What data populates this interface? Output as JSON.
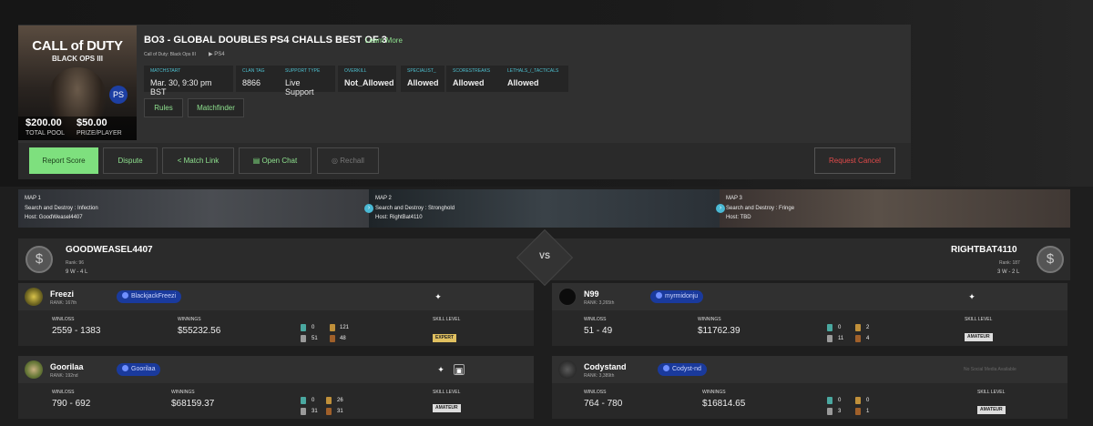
{
  "game": {
    "cover_title": "CALL of DUTY",
    "cover_subtitle": "BLACK OPS III",
    "platform_badge": "PS"
  },
  "pool": {
    "total": "$200.00",
    "total_label": "TOTAL POOL",
    "prize": "$50.00",
    "prize_label": "PRIZE/PLAYER"
  },
  "match": {
    "title": "BO3 - GLOBAL DOUBLES PS4 CHALLS BEST OF 3",
    "learn_more": "Learn More",
    "game_name": "Call of Duty: Black Ops III",
    "platform": "PS4"
  },
  "stats": [
    {
      "key": "MATCHSTART",
      "value": "Mar. 30, 9:30 pm BST"
    },
    {
      "key": "CLAN TAG",
      "value": "8866"
    },
    {
      "key": "SUPPORT TYPE",
      "value": "Live Support"
    },
    {
      "key": "OVERKILL",
      "value": "Not_Allowed"
    },
    {
      "key": "SPECIALIST_",
      "value": "Allowed"
    },
    {
      "key": "SCORESTREAKS",
      "value": "Allowed"
    },
    {
      "key": "LETHALS_/_TACTICALS",
      "value": "Allowed"
    }
  ],
  "links": {
    "rules": "Rules",
    "matchfinder": "Matchfinder"
  },
  "actions": {
    "report": "Report Score",
    "dispute": "Dispute",
    "match_link": "Match Link",
    "chat": "Open Chat",
    "rechall": "Rechall",
    "cancel": "Request Cancel"
  },
  "maps": [
    {
      "num": "MAP 1",
      "desc": "Search and Destroy : Infection",
      "host": "Host: GoodWeasel4407"
    },
    {
      "num": "MAP 2",
      "desc": "Search and Destroy : Stronghold",
      "host": "Host: RightBat4110"
    },
    {
      "num": "MAP 3",
      "desc": "Search and Destroy : Fringe",
      "host": "Host: TBD"
    }
  ],
  "teams": {
    "left": {
      "name": "GOODWEASEL4407",
      "rank": "Rank: 96",
      "record": "9 W - 4 L"
    },
    "right": {
      "name": "RIGHTBAT4110",
      "rank": "Rank: 187",
      "record": "3 W - 2 L"
    },
    "vs": "VS"
  },
  "labels": {
    "winloss": "WIN/LOSS",
    "winnings": "WINNINGS",
    "skill": "SKILL LEVEL",
    "no_social": "No Social Media Available"
  },
  "players": [
    {
      "name": "Freezi",
      "rank": "RANK: 167th",
      "psn": "BlackjackFreezi",
      "winloss": "2559 - 1383",
      "winnings": "$55232.56",
      "t_gold": "0",
      "t_bronze_top": "121",
      "t_silver": "51",
      "t_bronze": "48",
      "skill": "EXPERT"
    },
    {
      "name": "Goorilaa",
      "rank": "RANK: 192nd",
      "psn": "Goorilaa",
      "winloss": "790 - 692",
      "winnings": "$68159.37",
      "t_gold": "0",
      "t_bronze_top": "26",
      "t_silver": "31",
      "t_bronze": "31",
      "skill": "AMATEUR"
    },
    {
      "name": "N99",
      "rank": "RANK: 3,265th",
      "psn": "myrmidonju",
      "winloss": "51 - 49",
      "winnings": "$11762.39",
      "t_gold": "0",
      "t_bronze_top": "2",
      "t_silver": "11",
      "t_bronze": "4",
      "skill": "AMATEUR"
    },
    {
      "name": "Codystand",
      "rank": "RANK: 3,389th",
      "psn": "Codyst-nd",
      "winloss": "764 - 780",
      "winnings": "$16814.65",
      "t_gold": "0",
      "t_bronze_top": "0",
      "t_silver": "3",
      "t_bronze": "1",
      "skill": "AMATEUR"
    }
  ],
  "colors": {
    "accent_green": "#7ee07e",
    "link_green": "#8fe28f",
    "cancel_red": "#e04a4a",
    "psn_blue": "#1a3a9c",
    "info_cyan": "#4dc0d0"
  }
}
